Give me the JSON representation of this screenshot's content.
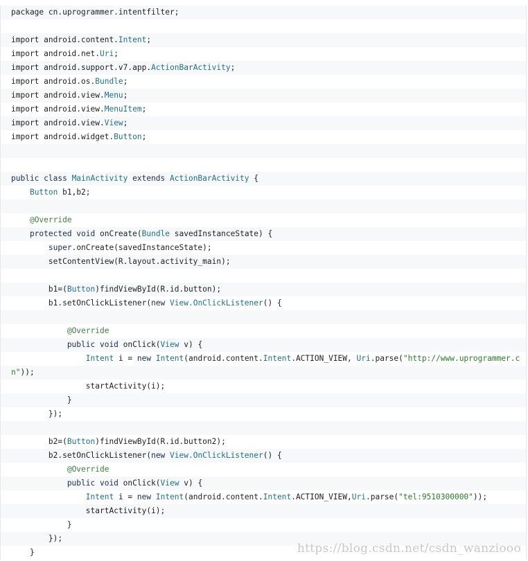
{
  "code": {
    "lines": [
      [
        {
          "t": "package cn.uprogrammer.intentfilter;",
          "c": "plain"
        }
      ],
      [],
      [
        {
          "t": "import android.content.",
          "c": "plain"
        },
        {
          "t": "Intent",
          "c": "type"
        },
        {
          "t": ";",
          "c": "plain"
        }
      ],
      [
        {
          "t": "import android.net.",
          "c": "plain"
        },
        {
          "t": "Uri",
          "c": "type"
        },
        {
          "t": ";",
          "c": "plain"
        }
      ],
      [
        {
          "t": "import android.support.v7.app.",
          "c": "plain"
        },
        {
          "t": "ActionBarActivity",
          "c": "type"
        },
        {
          "t": ";",
          "c": "plain"
        }
      ],
      [
        {
          "t": "import android.os.",
          "c": "plain"
        },
        {
          "t": "Bundle",
          "c": "type"
        },
        {
          "t": ";",
          "c": "plain"
        }
      ],
      [
        {
          "t": "import android.view.",
          "c": "plain"
        },
        {
          "t": "Menu",
          "c": "type"
        },
        {
          "t": ";",
          "c": "plain"
        }
      ],
      [
        {
          "t": "import android.view.",
          "c": "plain"
        },
        {
          "t": "MenuItem",
          "c": "type"
        },
        {
          "t": ";",
          "c": "plain"
        }
      ],
      [
        {
          "t": "import android.view.",
          "c": "plain"
        },
        {
          "t": "View",
          "c": "type"
        },
        {
          "t": ";",
          "c": "plain"
        }
      ],
      [
        {
          "t": "import android.widget.",
          "c": "plain"
        },
        {
          "t": "Button",
          "c": "type"
        },
        {
          "t": ";",
          "c": "plain"
        }
      ],
      [],
      [],
      [
        {
          "t": "public class ",
          "c": "kw"
        },
        {
          "t": "MainActivity",
          "c": "type"
        },
        {
          "t": " extends ",
          "c": "kw"
        },
        {
          "t": "ActionBarActivity",
          "c": "type"
        },
        {
          "t": " {",
          "c": "plain"
        }
      ],
      [
        {
          "t": "    ",
          "c": "plain"
        },
        {
          "t": "Button",
          "c": "type"
        },
        {
          "t": " b1,b2;",
          "c": "plain"
        }
      ],
      [],
      [
        {
          "t": "    ",
          "c": "plain"
        },
        {
          "t": "@Override",
          "c": "anno"
        }
      ],
      [
        {
          "t": "    protected void ",
          "c": "kw"
        },
        {
          "t": "onCreate",
          "c": "plain"
        },
        {
          "t": "(",
          "c": "plain"
        },
        {
          "t": "Bundle",
          "c": "type"
        },
        {
          "t": " savedInstanceState) {",
          "c": "plain"
        }
      ],
      [
        {
          "t": "        ",
          "c": "plain"
        },
        {
          "t": "super",
          "c": "kw"
        },
        {
          "t": ".onCreate(savedInstanceState);",
          "c": "plain"
        }
      ],
      [
        {
          "t": "        setContentView(R.layout.activity_main);",
          "c": "plain"
        }
      ],
      [],
      [
        {
          "t": "        b1=(",
          "c": "plain"
        },
        {
          "t": "Button",
          "c": "type"
        },
        {
          "t": ")findViewById(R.id.button);",
          "c": "plain"
        }
      ],
      [
        {
          "t": "        b1.setOnClickListener(",
          "c": "plain"
        },
        {
          "t": "new ",
          "c": "kw"
        },
        {
          "t": "View.OnClickListener",
          "c": "type"
        },
        {
          "t": "() {",
          "c": "plain"
        }
      ],
      [],
      [
        {
          "t": "            ",
          "c": "plain"
        },
        {
          "t": "@Override",
          "c": "anno"
        }
      ],
      [
        {
          "t": "            public void ",
          "c": "kw"
        },
        {
          "t": "onClick(",
          "c": "plain"
        },
        {
          "t": "View",
          "c": "type"
        },
        {
          "t": " v) {",
          "c": "plain"
        }
      ],
      [
        {
          "t": "                ",
          "c": "plain"
        },
        {
          "t": "Intent",
          "c": "type"
        },
        {
          "t": " i = ",
          "c": "plain"
        },
        {
          "t": "new ",
          "c": "kw"
        },
        {
          "t": "Intent",
          "c": "type"
        },
        {
          "t": "(android.content.",
          "c": "plain"
        },
        {
          "t": "Intent",
          "c": "type"
        },
        {
          "t": ".ACTION_VIEW, ",
          "c": "plain"
        },
        {
          "t": "Uri",
          "c": "type"
        },
        {
          "t": ".parse(",
          "c": "plain"
        },
        {
          "t": "\"http://www.uprogrammer.c",
          "c": "str"
        }
      ],
      [
        {
          "t": "n\"",
          "c": "str"
        },
        {
          "t": "));",
          "c": "plain"
        }
      ],
      [
        {
          "t": "                startActivity(i);",
          "c": "plain"
        }
      ],
      [
        {
          "t": "            }",
          "c": "plain"
        }
      ],
      [
        {
          "t": "        });",
          "c": "plain"
        }
      ],
      [],
      [
        {
          "t": "        b2=(",
          "c": "plain"
        },
        {
          "t": "Button",
          "c": "type"
        },
        {
          "t": ")findViewById(R.id.button2);",
          "c": "plain"
        }
      ],
      [
        {
          "t": "        b2.setOnClickListener(",
          "c": "plain"
        },
        {
          "t": "new ",
          "c": "kw"
        },
        {
          "t": "View.OnClickListener",
          "c": "type"
        },
        {
          "t": "() {",
          "c": "plain"
        }
      ],
      [
        {
          "t": "            ",
          "c": "plain"
        },
        {
          "t": "@Override",
          "c": "anno"
        }
      ],
      [
        {
          "t": "            public void ",
          "c": "kw"
        },
        {
          "t": "onClick(",
          "c": "plain"
        },
        {
          "t": "View",
          "c": "type"
        },
        {
          "t": " v) {",
          "c": "plain"
        }
      ],
      [
        {
          "t": "                ",
          "c": "plain"
        },
        {
          "t": "Intent",
          "c": "type"
        },
        {
          "t": " i = ",
          "c": "plain"
        },
        {
          "t": "new ",
          "c": "kw"
        },
        {
          "t": "Intent",
          "c": "type"
        },
        {
          "t": "(android.content.",
          "c": "plain"
        },
        {
          "t": "Intent",
          "c": "type"
        },
        {
          "t": ".ACTION_VIEW,",
          "c": "plain"
        },
        {
          "t": "Uri",
          "c": "type"
        },
        {
          "t": ".parse(",
          "c": "plain"
        },
        {
          "t": "\"tel:9510300000\"",
          "c": "str"
        },
        {
          "t": "));",
          "c": "plain"
        }
      ],
      [
        {
          "t": "                startActivity(i);",
          "c": "plain"
        }
      ],
      [
        {
          "t": "            }",
          "c": "plain"
        }
      ],
      [
        {
          "t": "        });",
          "c": "plain"
        }
      ],
      [
        {
          "t": "    }",
          "c": "plain"
        }
      ]
    ]
  },
  "watermark": "https://blog.csdn.net/csdn_wanziooo",
  "colors": {
    "background": "#ffffff",
    "stripe": "#f6f8fa",
    "keyword": "#1a2b5c",
    "type": "#1d6f8e",
    "string": "#2a7a2a",
    "annotation": "#3f7f3f",
    "text": "#222222",
    "watermark": "#c8c8c8"
  }
}
